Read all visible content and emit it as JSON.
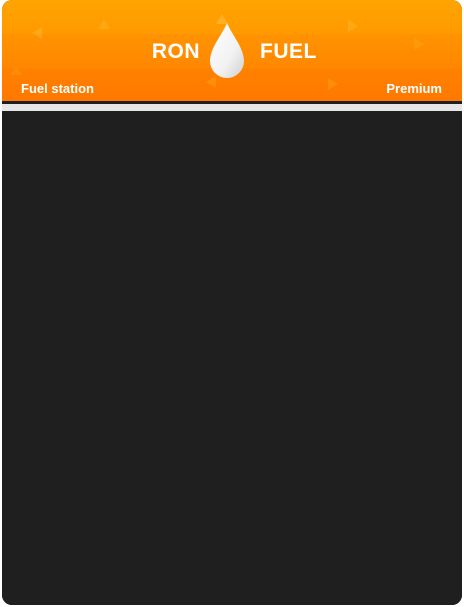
{
  "header": {
    "brand_left": "RON",
    "brand_right": "FUEL",
    "logo_icon": "fuel-drop-icon",
    "station_label": "Fuel station",
    "grade_label": "Premium"
  },
  "colors": {
    "header_top": "#ffa400",
    "header_bottom": "#ff7f00",
    "divider": "#e6e6e6",
    "panel": "#1f1f1f",
    "text": "#ffffff"
  }
}
